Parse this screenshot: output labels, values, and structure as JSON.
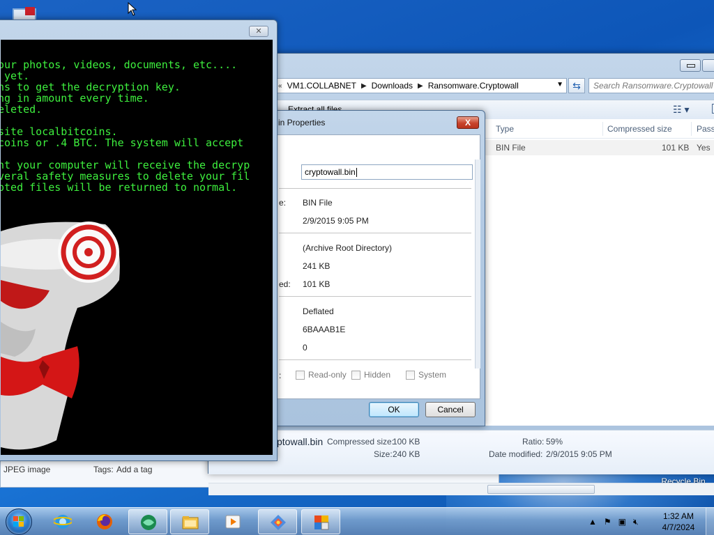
{
  "desktop": {
    "recycle_bin_label": "Recycle Bin"
  },
  "back_window": {
    "file_type": "JPEG image",
    "tags_label": "Tags:",
    "tags_value": "Add a tag"
  },
  "explorer": {
    "breadcrumbs": [
      "VM1.COLLABNET",
      "Downloads",
      "Ransomware.Cryptowall"
    ],
    "search_placeholder": "Search Ransomware.Cryptowall",
    "command": "Extract all files",
    "columns": [
      "Type",
      "Compressed size",
      "Passw"
    ],
    "row": {
      "type": "BIN File",
      "compressed_size": "101 KB",
      "password": "Yes"
    },
    "details": {
      "name": "ptowall.bin",
      "compressed_label": "Compressed size:",
      "compressed_value": "100 KB",
      "size_label": "Size:",
      "size_value": "240 KB",
      "ratio_label": "Ratio:",
      "ratio_value": "59%",
      "modified_label": "Date modified:",
      "modified_value": "2/9/2015 9:05 PM"
    }
  },
  "properties": {
    "title": "in Properties",
    "close": "X",
    "name_value": "cryptowall.bin",
    "type_label": "e:",
    "type_value": "BIN File",
    "modified_value": "2/9/2015 9:05 PM",
    "location_value": "(Archive Root Directory)",
    "size_value": "241 KB",
    "packed_label": "ed:",
    "packed_value": "101 KB",
    "method_value": "Deflated",
    "crc_value": "6BAAAB1E",
    "index_value": "0",
    "attributes_label": ":",
    "checkboxes": [
      "Read-only",
      "Hidden",
      "System"
    ],
    "ok_label": "OK",
    "cancel_label": "Cancel"
  },
  "ransom_note": {
    "lines": [
      "our photos, videos, documents, etc....",
      " yet.",
      "ns to get the decryption key.",
      "ng in amount every time.",
      "eleted.",
      "",
      "site localbitcoins.",
      "coins or .4 BTC. The system will accept",
      "",
      "nt your computer will receive the decryp",
      "veral safety measures to delete your fil",
      "pted files will be returned to normal."
    ],
    "text_color": "#3ef03e"
  },
  "taskbar": {
    "time": "1:32 AM",
    "date": "4/7/2024",
    "apps": [
      "internet-explorer",
      "firefox",
      "network-app",
      "file-explorer",
      "media-player",
      "paint-app",
      "office-app"
    ]
  },
  "colors": {
    "desktop_blue": "#1b63c4",
    "close_red": "#c8432c",
    "terminal_green": "#3ef03e"
  }
}
